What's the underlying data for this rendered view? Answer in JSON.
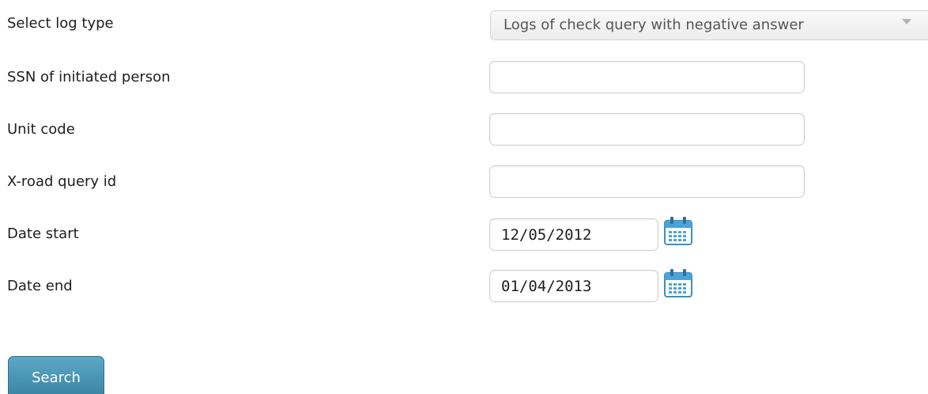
{
  "form": {
    "log_type": {
      "label": "Select log type",
      "selected": "Logs of check query with negative answer"
    },
    "ssn": {
      "label": "SSN of initiated person",
      "value": "",
      "placeholder": ""
    },
    "unit_code": {
      "label": "Unit code",
      "value": "",
      "placeholder": ""
    },
    "xroad_query_id": {
      "label": "X-road query id",
      "value": "",
      "placeholder": ""
    },
    "date_start": {
      "label": "Date start",
      "value": "12/05/2012"
    },
    "date_end": {
      "label": "Date end",
      "value": "01/04/2013"
    },
    "search_label": "Search"
  },
  "icons": {
    "calendar": "calendar-icon",
    "dropdown": "chevron-down-icon"
  },
  "colors": {
    "button": "#4a97b6",
    "calendar": "#4ba3d8"
  }
}
